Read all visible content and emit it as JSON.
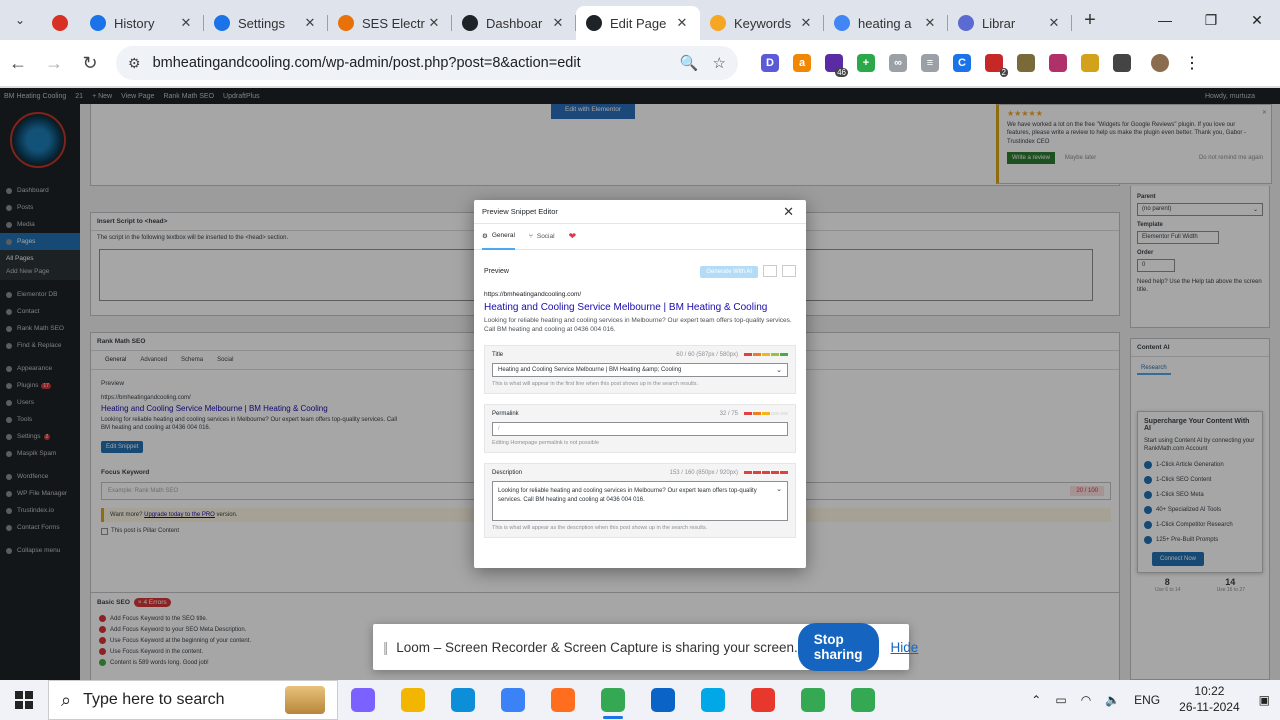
{
  "browser": {
    "tabs": [
      {
        "title": "",
        "icon": "record-icon",
        "color": "#d93025",
        "pinned": true
      },
      {
        "title": "History",
        "icon": "history-icon",
        "color": "#1a73e8"
      },
      {
        "title": "Settings",
        "icon": "gear-icon",
        "color": "#1a73e8"
      },
      {
        "title": "SES Electr",
        "icon": "ses-icon",
        "color": "#e8710a"
      },
      {
        "title": "Dashboar",
        "icon": "wp-icon",
        "color": "#1d2327"
      },
      {
        "title": "Edit Page",
        "icon": "wp-icon",
        "color": "#1d2327",
        "active": true
      },
      {
        "title": "Keywords",
        "icon": "ahrefs-icon",
        "color": "#f5a623"
      },
      {
        "title": "heating a",
        "icon": "google-icon",
        "color": "#4285f4"
      },
      {
        "title": "Librar",
        "icon": "library-icon",
        "color": "#5b6bd1"
      }
    ],
    "url": "bmheatingandcooling.com/wp-admin/post.php?post=8&action=edit",
    "extensions": [
      {
        "name": "ext-d-icon",
        "label": "D",
        "color": "#5b5bd6"
      },
      {
        "name": "ext-amazon-icon",
        "label": "a",
        "color": "#f08804"
      },
      {
        "name": "ext-hat-icon",
        "label": "",
        "color": "#5b2ba6",
        "badge": "46"
      },
      {
        "name": "ext-plus-icon",
        "label": "+",
        "color": "#2aa84a"
      },
      {
        "name": "ext-link-icon",
        "label": "∞",
        "color": "#9aa0a6"
      },
      {
        "name": "ext-bar-icon",
        "label": "≡",
        "color": "#9aa0a6"
      },
      {
        "name": "ext-c-icon",
        "label": "C",
        "color": "#1a73e8"
      },
      {
        "name": "ext-grid-icon",
        "label": "",
        "color": "#c62828",
        "badge": "2"
      },
      {
        "name": "ext-folder-icon",
        "label": "",
        "color": "#7a6a3a"
      },
      {
        "name": "ext-robot-icon",
        "label": "",
        "color": "#b0306a"
      },
      {
        "name": "ext-note-icon",
        "label": "",
        "color": "#d4a21a"
      },
      {
        "name": "ext-puzzle-icon",
        "label": "",
        "color": "#444444"
      }
    ]
  },
  "adminbar": {
    "items": [
      "BM Heating Cooling",
      "21",
      "+ New",
      "View Page",
      "Rank Math SEO",
      "UpdraftPlus"
    ],
    "howdy": "Howdy, murtuza"
  },
  "sidebar": {
    "items": [
      {
        "label": "Dashboard"
      },
      {
        "label": "Posts"
      },
      {
        "label": "Media"
      },
      {
        "label": "Pages",
        "current": true
      },
      {
        "label": "Elementor DB"
      },
      {
        "label": "Contact"
      },
      {
        "label": "Rank Math SEO"
      },
      {
        "label": "Find & Replace"
      },
      {
        "label": "Appearance"
      },
      {
        "label": "Plugins",
        "count": "17"
      },
      {
        "label": "Users"
      },
      {
        "label": "Tools"
      },
      {
        "label": "Settings",
        "count": "2"
      },
      {
        "label": "Maspik Spam"
      },
      {
        "label": "Wordfence"
      },
      {
        "label": "WP File Manager"
      },
      {
        "label": "Trustindex.io"
      },
      {
        "label": "Contact Forms"
      },
      {
        "label": "Collapse menu"
      }
    ],
    "sub": [
      "All Pages",
      "Add New Page"
    ]
  },
  "editor": {
    "elementor_button": "Edit with Elementor",
    "insert_script_title": "Insert Script to <head>",
    "insert_script_desc": "The script in the following textbox will be inserted to the <head> section.",
    "rankmath_title": "Rank Math SEO",
    "rm_tabs": [
      "General",
      "Advanced",
      "Schema",
      "Social"
    ],
    "preview_label": "Preview",
    "snippet_url": "https://bmheatingandcooling.com/",
    "snippet_title": "Heating and Cooling Service Melbourne | BM Heating & Cooling",
    "snippet_desc": "Looking for reliable heating and cooling services in Melbourne? Our expert team offers top-quality services. Call BM heating and cooling at 0436 004 016.",
    "edit_snippet": "Edit Snippet",
    "focus_keyword": "Focus Keyword",
    "focus_placeholder": "Example: Rank Math SEO",
    "score": "20 / 100",
    "want_more": "Want more?",
    "upgrade_link": "Upgrade today to the PRO",
    "want_more_suffix": "version.",
    "pillar": "This post is Pillar Content",
    "basic_seo": "Basic SEO",
    "basic_errors": "× 4 Errors",
    "checks": [
      "Add Focus Keyword to the SEO title.",
      "Add Focus Keyword to your SEO Meta Description.",
      "Use Focus Keyword at the beginning of your content.",
      "Use Focus Keyword in the content.",
      "Content is 589 words long. Good job!"
    ]
  },
  "trustindex": {
    "stars": "★★★★★",
    "text": "We have worked a lot on the free \"Widgets for Google Reviews\" plugin. If you love our features, please write a review to help us make the plugin even better. Thank you, Gabor - Trustindex CEO",
    "write_review": "Write a review",
    "maybe_later": "Maybe later",
    "do_not_remind": "Do not remind me again"
  },
  "attributes": {
    "parent_label": "Parent",
    "parent_value": "(no parent)",
    "template_label": "Template",
    "template_value": "Elementor Full Width",
    "order_label": "Order",
    "order_value": "0",
    "help": "Need help? Use the Help tab above the screen title."
  },
  "content_ai": {
    "title": "Content AI",
    "tab": "Research",
    "heading": "Supercharge Your Content With AI",
    "desc": "Start using Content AI by connecting your RankMath.com Account",
    "features": [
      "1-Click Article Generation",
      "1-Click SEO Content",
      "1-Click SEO Meta",
      "40+ Specialized AI Tools",
      "1-Click Competitor Research",
      "125+ Pre-Built Prompts"
    ],
    "connect": "Connect Now",
    "stat1": "8",
    "stat1_label": "Use 6 to 14",
    "stat2": "14",
    "stat2_label": "Use 16 to 27"
  },
  "modal": {
    "title": "Preview Snippet Editor",
    "tabs": [
      "General",
      "Social"
    ],
    "preview": "Preview",
    "ai_button": "Generate With AI",
    "url": "https://bmheatingandcooling.com/",
    "serp_title": "Heating and Cooling Service Melbourne | BM Heating & Cooling",
    "serp_desc": "Looking for reliable heating and cooling services in Melbourne? Our expert team offers top-quality services. Call BM heating and cooling at 0436 004 016.",
    "title_label": "Title",
    "title_meta": "60 / 60 (587px / 580px)",
    "title_value": "Heating and Cooling Service Melbourne | BM Heating &amp; Cooling",
    "title_hint": "This is what will appear in the first line when this post shows up in the search results.",
    "permalink_label": "Permalink",
    "permalink_meta": "32 / 75",
    "permalink_value": "/",
    "permalink_hint": "Editing Homepage permalink is not possible",
    "desc_label": "Description",
    "desc_meta": "153 / 160 (850px / 920px)",
    "desc_value": "Looking for reliable heating and cooling services in Melbourne? Our expert team offers top-quality services. Call BM heating and cooling at 0436 004 016.",
    "desc_hint": "This is what will appear as the description when this post shows up in the search results."
  },
  "loom": {
    "message": "Loom – Screen Recorder & Screen Capture is sharing your screen.",
    "stop": "Stop sharing",
    "hide": "Hide"
  },
  "taskbar": {
    "search_placeholder": "Type here to search",
    "apps": [
      {
        "name": "copilot-icon",
        "color": "#7b61ff"
      },
      {
        "name": "file-explorer-icon",
        "color": "#f2b600"
      },
      {
        "name": "edge-icon",
        "color": "#0c8fd8"
      },
      {
        "name": "cloud-icon",
        "color": "#3b82f6"
      },
      {
        "name": "firefox-icon",
        "color": "#ff6d1f"
      },
      {
        "name": "chrome-icon",
        "color": "#34a853",
        "active": true
      },
      {
        "name": "outlook-icon",
        "color": "#0a64c8"
      },
      {
        "name": "skype-icon",
        "color": "#00a8e8"
      },
      {
        "name": "wps-icon",
        "color": "#e8372d"
      },
      {
        "name": "chrome-profile-icon",
        "color": "#34a853"
      },
      {
        "name": "chrome-profile2-icon",
        "color": "#34a853"
      }
    ],
    "lang": "ENG",
    "time": "10:22",
    "date": "26-11-2024"
  }
}
